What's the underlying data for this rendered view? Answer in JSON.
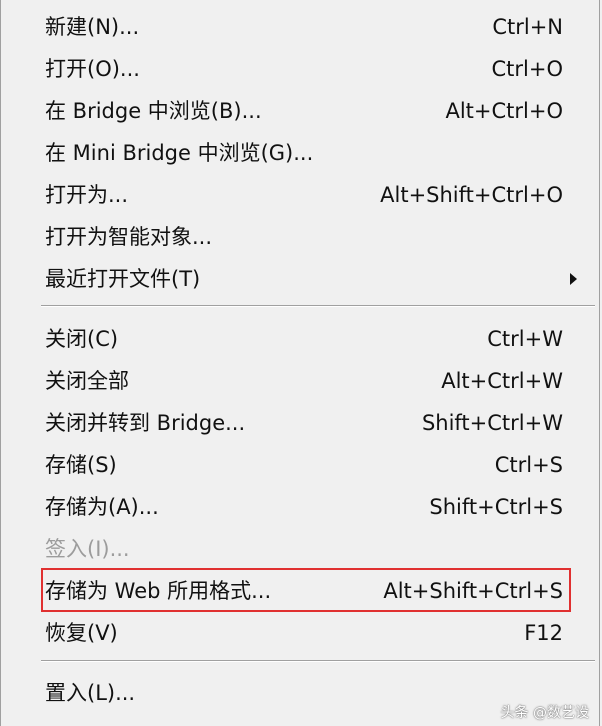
{
  "menu": {
    "items": [
      {
        "label": "新建(N)...",
        "shortcut": "Ctrl+N"
      },
      {
        "label": "打开(O)...",
        "shortcut": "Ctrl+O"
      },
      {
        "label": "在 Bridge 中浏览(B)...",
        "shortcut": "Alt+Ctrl+O"
      },
      {
        "label": "在 Mini Bridge 中浏览(G)...",
        "shortcut": ""
      },
      {
        "label": "打开为...",
        "shortcut": "Alt+Shift+Ctrl+O"
      },
      {
        "label": "打开为智能对象...",
        "shortcut": ""
      },
      {
        "label": "最近打开文件(T)",
        "shortcut": "",
        "submenu_icon": "triangle-right-icon"
      },
      {
        "label": "关闭(C)",
        "shortcut": "Ctrl+W"
      },
      {
        "label": "关闭全部",
        "shortcut": "Alt+Ctrl+W"
      },
      {
        "label": "关闭并转到 Bridge...",
        "shortcut": "Shift+Ctrl+W"
      },
      {
        "label": "存储(S)",
        "shortcut": "Ctrl+S"
      },
      {
        "label": "存储为(A)...",
        "shortcut": "Shift+Ctrl+S"
      },
      {
        "label": "签入(I)...",
        "shortcut": "",
        "disabled": true
      },
      {
        "label": "存储为 Web 所用格式...",
        "shortcut": "Alt+Shift+Ctrl+S",
        "highlighted": true
      },
      {
        "label": "恢复(V)",
        "shortcut": "F12"
      },
      {
        "label": "置入(L)...",
        "shortcut": ""
      }
    ]
  },
  "watermark": "头条 @数艺设",
  "colors": {
    "menu_background": "#f0f0f0",
    "text": "#111111",
    "disabled_text": "#9c9c9c",
    "highlight_border": "#e03030",
    "separator": "#a0a0a0"
  }
}
